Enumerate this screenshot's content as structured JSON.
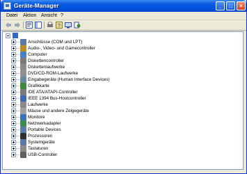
{
  "window": {
    "title": "Geräte-Manager",
    "minimize": "_",
    "maximize": "□",
    "close": "×"
  },
  "menu": [
    "Datei",
    "Aktion",
    "Ansicht",
    "?"
  ],
  "toolbar": {
    "icons": [
      "back-arrow-icon",
      "forward-arrow-icon",
      "properties-icon",
      "tree-view-icon",
      "print-icon",
      "help-icon",
      "scan-hardware-icon",
      "update-icon"
    ]
  },
  "tree": {
    "items": [
      {
        "label": "Anschlüsse (COM und LPT)",
        "icon_color": "#5a7aa8"
      },
      {
        "label": "Audio-, Video- und Gamecontroller",
        "icon_color": "#c08a20"
      },
      {
        "label": "Computer",
        "icon_color": "#4a80c8"
      },
      {
        "label": "Diskettencontroller",
        "icon_color": "#7a7a7a"
      },
      {
        "label": "Diskettenlaufwerke",
        "icon_color": "#8a8a8a"
      },
      {
        "label": "DVD/CD-ROM-Laufwerke",
        "icon_color": "#909090"
      },
      {
        "label": "Eingabegeräte (Human Interface Devices)",
        "icon_color": "#6a8aa0"
      },
      {
        "label": "Grafikkarte",
        "icon_color": "#3a8a3a"
      },
      {
        "label": "IDE ATA/ATAPI-Controller",
        "icon_color": "#7a7a7a"
      },
      {
        "label": "IEEE 1394 Bus-Hostcontroller",
        "icon_color": "#3a6ab0"
      },
      {
        "label": "Laufwerke",
        "icon_color": "#8a8a8a"
      },
      {
        "label": "Mäuse und andere Zeigegeräte",
        "icon_color": "#a0a0a0"
      },
      {
        "label": "Monitore",
        "icon_color": "#3a70c0"
      },
      {
        "label": "Netzwerkadapter",
        "icon_color": "#3a8a50"
      },
      {
        "label": "Portable Devices",
        "icon_color": "#5a7ab0"
      },
      {
        "label": "Prozessoren",
        "icon_color": "#303030"
      },
      {
        "label": "Systemgeräte",
        "icon_color": "#5a7aa8"
      },
      {
        "label": "Tastaturen",
        "icon_color": "#8a8a8a"
      },
      {
        "label": "USB-Controller",
        "icon_color": "#606060"
      }
    ]
  }
}
